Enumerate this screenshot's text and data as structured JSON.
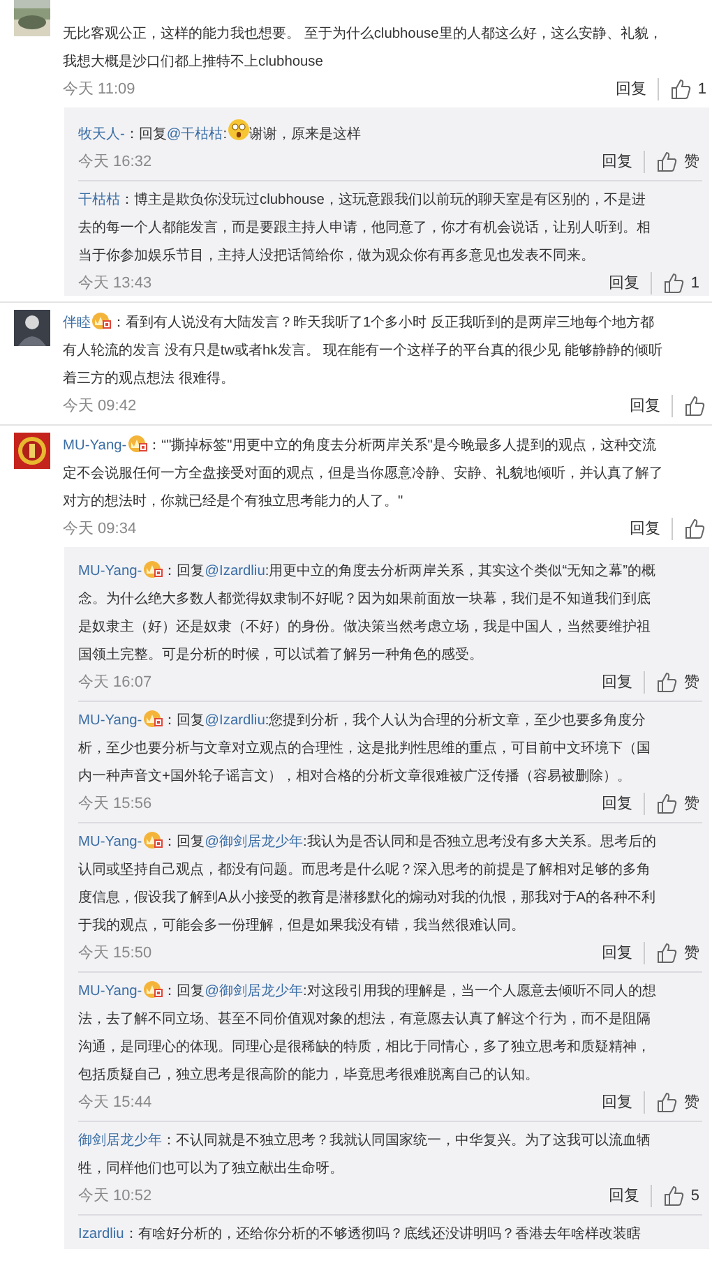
{
  "comments": [
    {
      "badge": false,
      "lines": [
        "无比客观公正，这样的能力我也想要。 至于为什么clubhouse里的人都这么好，这么安静、礼貌，",
        "我想大概是沙口们都上推特不上clubhouse"
      ],
      "time": "今天 11:09",
      "reply_label": "回复",
      "like_label": "1",
      "replies": [
        {
          "author": "牧天人-",
          "badge": false,
          "separator": "：",
          "reply_prefix": "回复",
          "mention": "@干枯枯",
          "mention_colon": ":",
          "emoji": true,
          "lines": [
            "谢谢，原来是这样"
          ],
          "time": "今天 16:32",
          "reply_label": "回复",
          "like_label": "赞"
        },
        {
          "author": "干枯枯",
          "badge": false,
          "separator": "：",
          "emoji": false,
          "lines": [
            "博主是欺负你没玩过clubhouse，这玩意跟我们以前玩的聊天室是有区别的，不是进",
            "去的每一个人都能发言，而是要跟主持人申请，他同意了，你才有机会说话，让别人听到。相",
            "当于你参加娱乐节目，主持人没把话筒给你，做为观众你有再多意见也发表不同来。"
          ],
          "time": "今天 13:43",
          "reply_label": "回复",
          "like_label": "1"
        }
      ]
    },
    {
      "author": "伴睦",
      "badge": true,
      "separator": "：",
      "lines": [
        "看到有人说没有大陆发言？昨天我听了1个多小时 反正我听到的是两岸三地每个地方都",
        "有人轮流的发言 没有只是tw或者hk发言。 现在能有一个这样子的平台真的很少见 能够静静的倾听",
        "着三方的观点想法 很难得。"
      ],
      "time": "今天 09:42",
      "reply_label": "回复"
    },
    {
      "author": "MU-Yang-",
      "badge": true,
      "separator": "：",
      "lines": [
        "“\"撕掉标签\"用更中立的角度去分析两岸关系\"是今晚最多人提到的观点，这种交流",
        "定不会说服任何一方全盘接受对面的观点，但是当你愿意冷静、安静、礼貌地倾听，并认真了解了",
        "对方的想法时，你就已经是个有独立思考能力的人了。\""
      ],
      "time": "今天 09:34",
      "reply_label": "回复",
      "replies": [
        {
          "author": "MU-Yang-",
          "badge": true,
          "separator": "：",
          "reply_prefix": "回复",
          "mention": "@Izardliu",
          "mention_colon": ":",
          "emoji": false,
          "lines": [
            "用更中立的角度去分析两岸关系，其实这个类似“无知之幕”的概",
            "念。为什么绝大多数人都觉得奴隶制不好呢？因为如果前面放一块幕，我们是不知道我们到底",
            "是奴隶主（好）还是奴隶（不好）的身份。做决策当然考虑立场，我是中国人，当然要维护祖",
            "国领土完整。可是分析的时候，可以试着了解另一种角色的感受。"
          ],
          "time": "今天 16:07",
          "reply_label": "回复",
          "like_label": "赞"
        },
        {
          "author": "MU-Yang-",
          "badge": true,
          "separator": "：",
          "reply_prefix": "回复",
          "mention": "@Izardliu",
          "mention_colon": ":",
          "emoji": false,
          "lines": [
            "您提到分析，我个人认为合理的分析文章，至少也要多角度分",
            "析，至少也要分析与文章对立观点的合理性，这是批判性思维的重点，可目前中文环境下（国",
            "内一种声音文+国外轮子谣言文），相对合格的分析文章很难被广泛传播（容易被删除）。"
          ],
          "time": "今天 15:56",
          "reply_label": "回复",
          "like_label": "赞"
        },
        {
          "author": "MU-Yang-",
          "badge": true,
          "separator": "：",
          "reply_prefix": "回复",
          "mention": "@御剑居龙少年",
          "mention_colon": ":",
          "emoji": false,
          "lines": [
            "我认为是否认同和是否独立思考没有多大关系。思考后的",
            "认同或坚持自己观点，都没有问题。而思考是什么呢？深入思考的前提是了解相对足够的多角",
            "度信息，假设我了解到A从小接受的教育是潜移默化的煽动对我的仇恨，那我对于A的各种不利",
            "于我的观点，可能会多一份理解，但是如果我没有错，我当然很难认同。"
          ],
          "time": "今天 15:50",
          "reply_label": "回复",
          "like_label": "赞"
        },
        {
          "author": "MU-Yang-",
          "badge": true,
          "separator": "：",
          "reply_prefix": "回复",
          "mention": "@御剑居龙少年",
          "mention_colon": ":",
          "emoji": false,
          "lines": [
            "对这段引用我的理解是，当一个人愿意去倾听不同人的想",
            "法，去了解不同立场、甚至不同价值观对象的想法，有意愿去认真了解这个行为，而不是阻隔",
            "沟通，是同理心的体现。同理心是很稀缺的特质，相比于同情心，多了独立思考和质疑精神，",
            "包括质疑自己，独立思考是很高阶的能力，毕竟思考很难脱离自己的认知。"
          ],
          "time": "今天 15:44",
          "reply_label": "回复",
          "like_label": "赞"
        },
        {
          "author": "御剑居龙少年",
          "badge": false,
          "separator": "：",
          "emoji": false,
          "lines": [
            "不认同就是不独立思考？我就认同国家统一，中华复兴。为了这我可以流血牺",
            "牲，同样他们也可以为了独立献出生命呀。"
          ],
          "time": "今天 10:52",
          "reply_label": "回复",
          "like_label": "5"
        },
        {
          "author": "Izardliu",
          "badge": false,
          "separator": "：",
          "emoji": false,
          "lines": [
            "有啥好分析的，还给你分析的不够透彻吗？底线还没讲明吗？香港去年啥样改装瞎"
          ]
        }
      ]
    }
  ]
}
